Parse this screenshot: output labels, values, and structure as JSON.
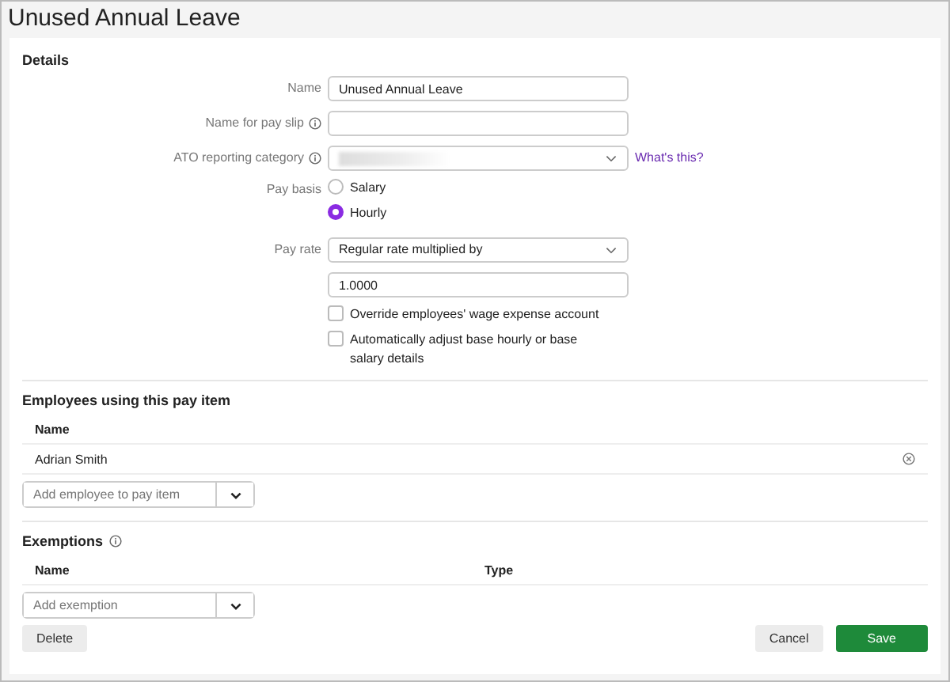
{
  "page_title": "Unused Annual Leave",
  "details": {
    "heading": "Details",
    "name": {
      "label": "Name",
      "value": "Unused Annual Leave"
    },
    "pay_slip_name": {
      "label": "Name for pay slip"
    },
    "ato_category": {
      "label": "ATO reporting category",
      "link": "What's this?"
    },
    "pay_basis": {
      "label": "Pay basis",
      "options": [
        {
          "label": "Salary",
          "selected": false
        },
        {
          "label": "Hourly",
          "selected": true
        }
      ]
    },
    "pay_rate": {
      "label": "Pay rate",
      "value": "Regular rate multiplied by",
      "multiplier": "1.0000"
    },
    "checkboxes": [
      {
        "label": "Override employees' wage expense account",
        "checked": false
      },
      {
        "label": "Automatically adjust base hourly or base salary details",
        "checked": false
      }
    ]
  },
  "employees": {
    "heading": "Employees using this pay item",
    "columns": [
      "Name"
    ],
    "rows": [
      {
        "name": "Adrian Smith"
      }
    ],
    "add_placeholder": "Add employee to pay item"
  },
  "exemptions": {
    "heading": "Exemptions",
    "columns": [
      "Name",
      "Type"
    ],
    "add_placeholder": "Add exemption"
  },
  "buttons": {
    "delete": "Delete",
    "cancel": "Cancel",
    "save": "Save"
  }
}
